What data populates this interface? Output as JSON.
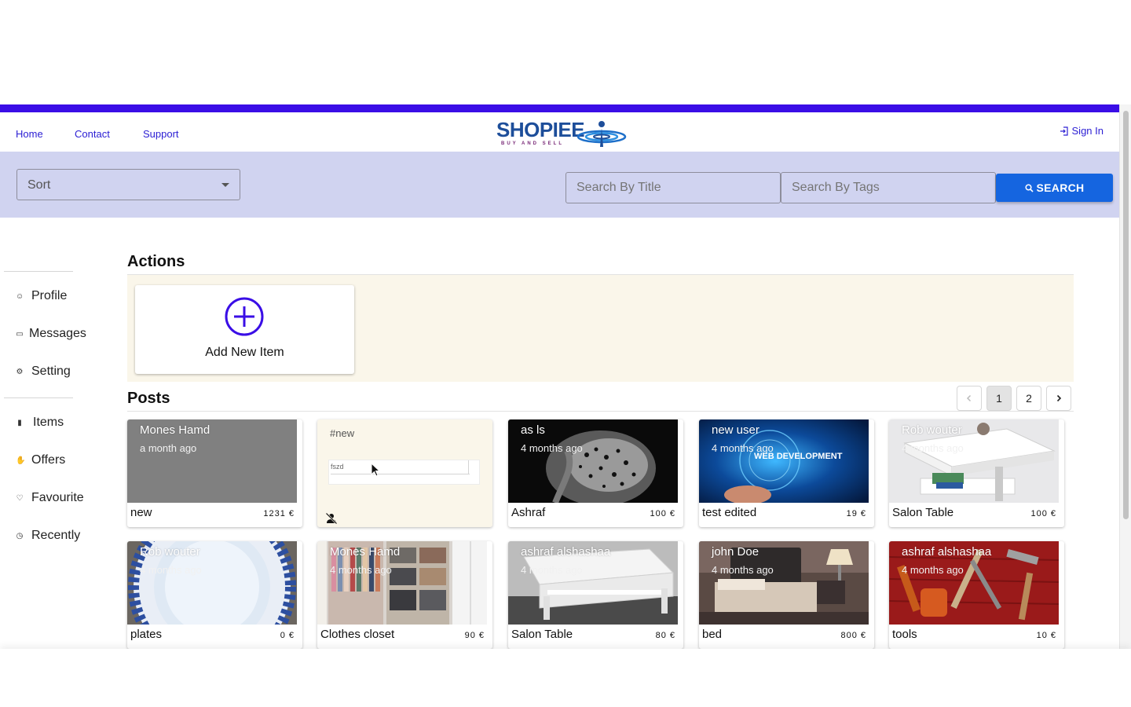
{
  "nav": {
    "links": [
      "Home",
      "Contact",
      "Support"
    ],
    "logo": {
      "word": "SHOPIEE",
      "tagline": "BUY AND SELL"
    },
    "signin": "Sign In"
  },
  "filters": {
    "sort_label": "Sort",
    "search_title_placeholder": "Search By Title",
    "search_tags_placeholder": "Search By Tags",
    "search_button": "SEARCH"
  },
  "sidebar": {
    "group1": [
      "Profile",
      "Messages",
      "Setting"
    ],
    "group2": [
      "Items",
      "Offers",
      "Favourite",
      "Recently"
    ]
  },
  "actions": {
    "title": "Actions",
    "add_item": "Add New Item"
  },
  "posts": {
    "title": "Posts",
    "pages": [
      "1",
      "2"
    ],
    "current_page": "1",
    "cards": [
      {
        "owner": "Mones Hamd",
        "ago": "a month ago",
        "title": "new",
        "price": "1231 €",
        "image": "grey-placeholder"
      },
      {
        "tag": "#new",
        "body": "fszd",
        "icon": "no-person-icon"
      },
      {
        "owner": "as ls",
        "ago": "4 months ago",
        "title": "Ashraf",
        "price": "100 €",
        "image": "leopard"
      },
      {
        "owner": "new user",
        "ago": "4 months ago",
        "title": "test edited",
        "price": "19 €",
        "image": "web-development",
        "image_text": "WEB DEVELOPMENT"
      },
      {
        "owner": "Rob wouter",
        "ago": "4 months ago",
        "title": "Salon Table",
        "price": "100 €",
        "image": "white-table"
      },
      {
        "owner": "Rob wouter",
        "ago": "4 months ago",
        "title": "plates",
        "price": "0 €",
        "image": "plate"
      },
      {
        "owner": "Mones Hamd",
        "ago": "4 months ago",
        "title": "Clothes closet",
        "price": "90 €",
        "image": "closet"
      },
      {
        "owner": "ashraf alshashaa",
        "ago": "4 months ago",
        "title": "Salon Table",
        "price": "80 €",
        "image": "lift-table"
      },
      {
        "owner": "john Doe",
        "ago": "4 months ago",
        "title": "bed",
        "price": "800 €",
        "image": "bed"
      },
      {
        "owner": "ashraf alshashaa",
        "ago": "4 months ago",
        "title": "tools",
        "price": "10 €",
        "image": "tools"
      }
    ]
  },
  "colors": {
    "accent": "#3a0ee6",
    "filterbar": "#d0d3f0",
    "search_button": "#1565e0",
    "panel": "#faf6ea",
    "link": "#2d20d4"
  }
}
